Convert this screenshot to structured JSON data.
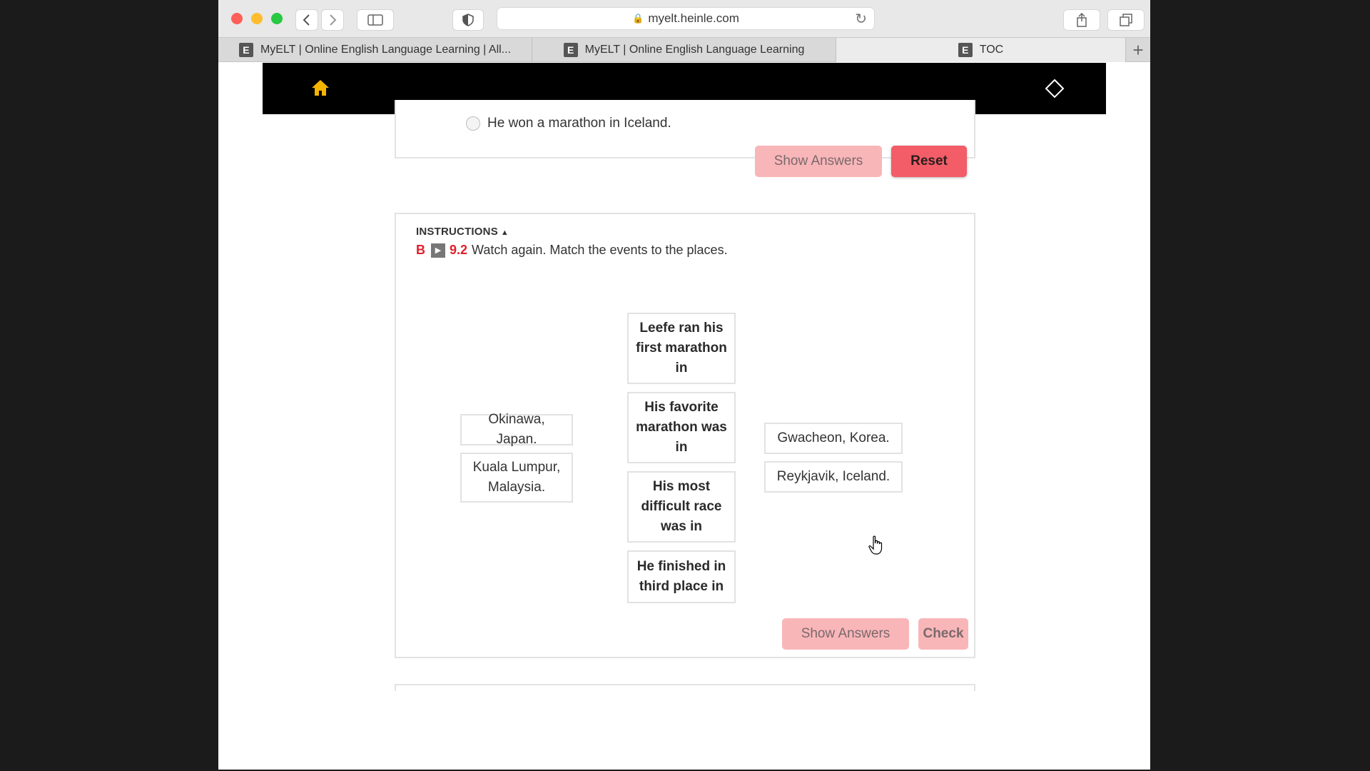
{
  "browser": {
    "url": "myelt.heinle.com",
    "tabs": [
      {
        "label": "MyELT | Online English Language Learning | All...",
        "favicon": "E"
      },
      {
        "label": "MyELT | Online English Language Learning",
        "favicon": "E"
      },
      {
        "label": "TOC",
        "favicon": "E"
      }
    ],
    "new_tab": "+"
  },
  "top_exercise": {
    "option_text": "He won a marathon in Iceland.",
    "show_answers_label": "Show Answers",
    "reset_label": "Reset"
  },
  "exercise_b": {
    "instructions_toggle": "INSTRUCTIONS",
    "letter": "B",
    "video_number": "9.2",
    "instruction_text": "Watch again. Match the events to the places.",
    "left_places": [
      "Okinawa, Japan.",
      "Kuala Lumpur, Malaysia."
    ],
    "prompts": [
      "Leefe ran his first marathon in",
      "His favorite marathon was in",
      "His most difficult race was in",
      "He finished in third place in"
    ],
    "right_places": [
      "Gwacheon, Korea.",
      "Reykjavik, Iceland."
    ],
    "show_answers_label": "Show Answers",
    "check_label": "Check"
  },
  "colors": {
    "accent_red": "#e0202c",
    "button_strong": "#f25d67",
    "button_light": "#f9b6b9",
    "home_icon": "#f5b400"
  }
}
